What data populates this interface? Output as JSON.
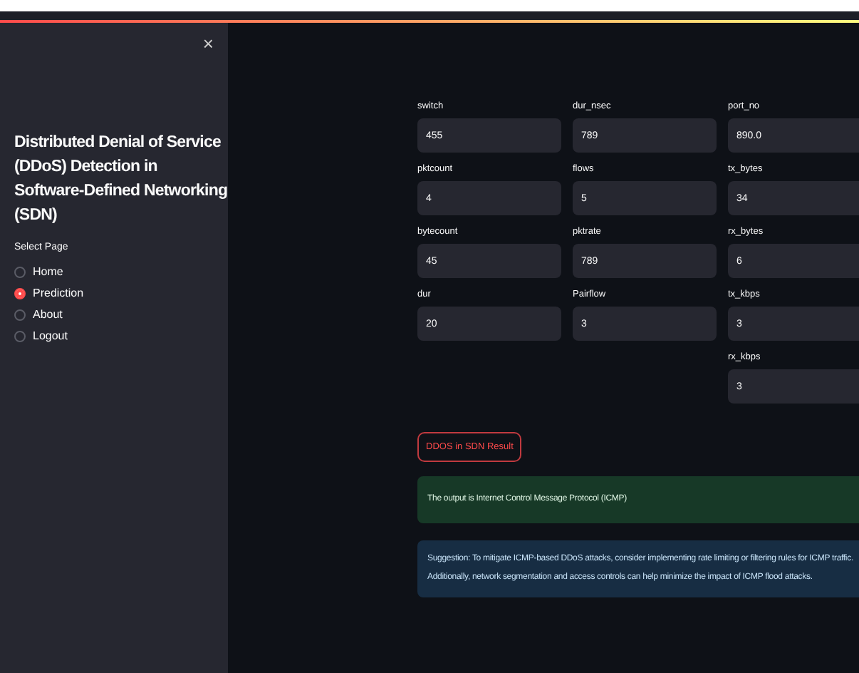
{
  "sidebar": {
    "close": "×",
    "title": "Distributed Denial of Service (DDoS) Detection in Software-Defined Networking (SDN)",
    "radio_label": "Select Page",
    "pages": [
      {
        "label": "Home",
        "selected": false
      },
      {
        "label": "Prediction",
        "selected": true
      },
      {
        "label": "About",
        "selected": false
      },
      {
        "label": "Logout",
        "selected": false
      }
    ]
  },
  "form": {
    "columns": [
      [
        {
          "label": "switch",
          "value": "455"
        },
        {
          "label": "pktcount",
          "value": "4"
        },
        {
          "label": "bytecount",
          "value": "45"
        },
        {
          "label": "dur",
          "value": "20"
        }
      ],
      [
        {
          "label": "dur_nsec",
          "value": "789"
        },
        {
          "label": "flows",
          "value": "5"
        },
        {
          "label": "pktrate",
          "value": "789"
        },
        {
          "label": "Pairflow",
          "value": "3"
        }
      ],
      [
        {
          "label": "port_no",
          "value": "890.0"
        },
        {
          "label": "tx_bytes",
          "value": "34"
        },
        {
          "label": "rx_bytes",
          "value": "6"
        },
        {
          "label": "tx_kbps",
          "value": "3"
        },
        {
          "label": "rx_kbps",
          "value": "3"
        }
      ]
    ],
    "button": "DDOS in SDN Result"
  },
  "messages": [
    {
      "kind": "success",
      "text": "The output is Internet Control Message Protocol (ICMP)"
    },
    {
      "kind": "info",
      "text": "Suggestion: To mitigate ICMP-based DDoS attacks, consider implementing rate limiting or filtering rules for ICMP traffic. Additionally, network segmentation and access controls can help minimize the impact of ICMP flood attacks."
    }
  ]
}
